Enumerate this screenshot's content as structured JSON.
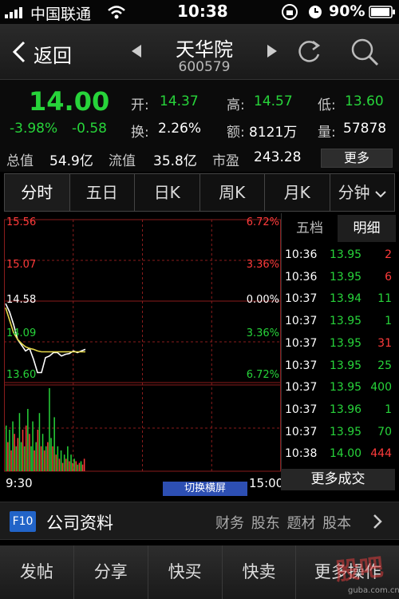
{
  "status_bar": {
    "carrier": "中国联通",
    "time": "10:38",
    "battery": "90%"
  },
  "header": {
    "back_label": "返回",
    "stock_name": "天华院",
    "stock_code": "600579"
  },
  "quote": {
    "price": "14.00",
    "change_pct": "-3.98%",
    "change": "-0.58",
    "open_label": "开:",
    "open": "14.37",
    "high_label": "高:",
    "high": "14.57",
    "low_label": "低:",
    "low": "13.60",
    "turnover_label": "换:",
    "turnover": "2.26%",
    "amount_label": "额:",
    "amount": "8121万",
    "volume_label": "量:",
    "volume": "57878",
    "mktcap_label": "总值",
    "mktcap": "54.9亿",
    "float_label": "流值",
    "float_cap": "35.8亿",
    "pe_label": "市盈",
    "pe": "243.28",
    "more_label": "更多"
  },
  "tabs": [
    {
      "label": "分时",
      "active": true
    },
    {
      "label": "五日",
      "active": false
    },
    {
      "label": "日K",
      "active": false
    },
    {
      "label": "周K",
      "active": false
    },
    {
      "label": "月K",
      "active": false
    },
    {
      "label": "分钟",
      "active": false
    }
  ],
  "chart": {
    "left_axis": [
      "15.56",
      "15.07",
      "14.58",
      "14.09",
      "13.60"
    ],
    "right_axis": [
      "6.72%",
      "3.36%",
      "0.00%",
      "3.36%",
      "6.72%"
    ],
    "time_start": "9:30",
    "time_end": "15:00",
    "switch_label": "切换横屏"
  },
  "chart_data": {
    "type": "line",
    "x_start": "9:30",
    "x_end": "15:00",
    "ylim": [
      13.6,
      15.56
    ],
    "reference_price": 14.58,
    "series": [
      {
        "values": [
          14.55,
          14.45,
          14.3,
          14.12,
          14.05,
          13.98,
          14.01,
          13.88,
          13.72,
          13.72,
          13.9,
          13.92,
          13.96,
          13.96,
          13.92,
          13.94,
          13.95,
          13.98,
          13.96,
          13.98,
          14.0
        ]
      },
      {
        "values": [
          14.5,
          14.35,
          14.2,
          14.12,
          14.07,
          14.03,
          14.01,
          14.0,
          13.98,
          13.97,
          13.97,
          13.97,
          13.97,
          13.97,
          13.97,
          13.97,
          13.97,
          13.97,
          13.97,
          13.97,
          13.97
        ]
      }
    ],
    "volume": [
      0.55,
      0.35,
      0.5,
      0.25,
      0.6,
      0.45,
      0.3,
      0.4,
      0.7,
      0.35,
      0.5,
      0.3,
      0.55,
      0.75,
      0.45,
      0.3,
      0.6,
      0.25,
      0.35,
      0.5,
      0.7,
      0.3,
      0.45,
      0.25,
      0.3,
      0.35,
      1.0,
      0.4,
      0.3,
      0.65,
      0.2,
      0.3,
      0.15,
      0.25,
      0.1,
      0.2,
      0.15,
      0.3,
      0.12,
      0.2,
      0.1,
      0.15,
      0.12,
      0.08,
      0.1,
      0.12,
      0.08,
      0.15
    ],
    "volume_colors": [
      "green",
      "red",
      "green",
      "red",
      "green",
      "red",
      "green",
      "red",
      "green",
      "green",
      "red",
      "green",
      "red",
      "green",
      "red",
      "green",
      "green",
      "red",
      "green",
      "red",
      "green",
      "red",
      "green",
      "red",
      "green",
      "red",
      "green",
      "green",
      "red",
      "green",
      "red",
      "green",
      "red",
      "green",
      "red",
      "green",
      "red",
      "green",
      "red",
      "green",
      "red",
      "green",
      "red",
      "green",
      "red",
      "green",
      "red",
      "red"
    ]
  },
  "detail": {
    "tab_five": "五档",
    "tab_detail": "明细",
    "trades": [
      {
        "time": "10:36",
        "price": "13.95",
        "vol": "2",
        "side": "red"
      },
      {
        "time": "10:36",
        "price": "13.95",
        "vol": "6",
        "side": "red"
      },
      {
        "time": "10:37",
        "price": "13.94",
        "vol": "11",
        "side": "green"
      },
      {
        "time": "10:37",
        "price": "13.95",
        "vol": "1",
        "side": "green"
      },
      {
        "time": "10:37",
        "price": "13.95",
        "vol": "31",
        "side": "red"
      },
      {
        "time": "10:37",
        "price": "13.95",
        "vol": "25",
        "side": "green"
      },
      {
        "time": "10:37",
        "price": "13.95",
        "vol": "400",
        "side": "green"
      },
      {
        "time": "10:37",
        "price": "13.96",
        "vol": "1",
        "side": "green"
      },
      {
        "time": "10:37",
        "price": "13.95",
        "vol": "70",
        "side": "green"
      },
      {
        "time": "10:38",
        "price": "14.00",
        "vol": "444",
        "side": "red"
      }
    ],
    "more_deals": "更多成交"
  },
  "f10": {
    "badge": "F10",
    "title": "公司资料",
    "links": "财务 股东 题材 股本"
  },
  "toolbar": [
    "发帖",
    "分享",
    "快买",
    "快卖",
    "更多操作"
  ],
  "watermark": {
    "logo": "股吧",
    "url": "guba.com.cn"
  },
  "colors": {
    "up": "#ff3b3b",
    "down": "#27d43a",
    "price_line": "#ffffff",
    "avg_line": "#e6d94a",
    "accent": "#2d4fb3"
  }
}
